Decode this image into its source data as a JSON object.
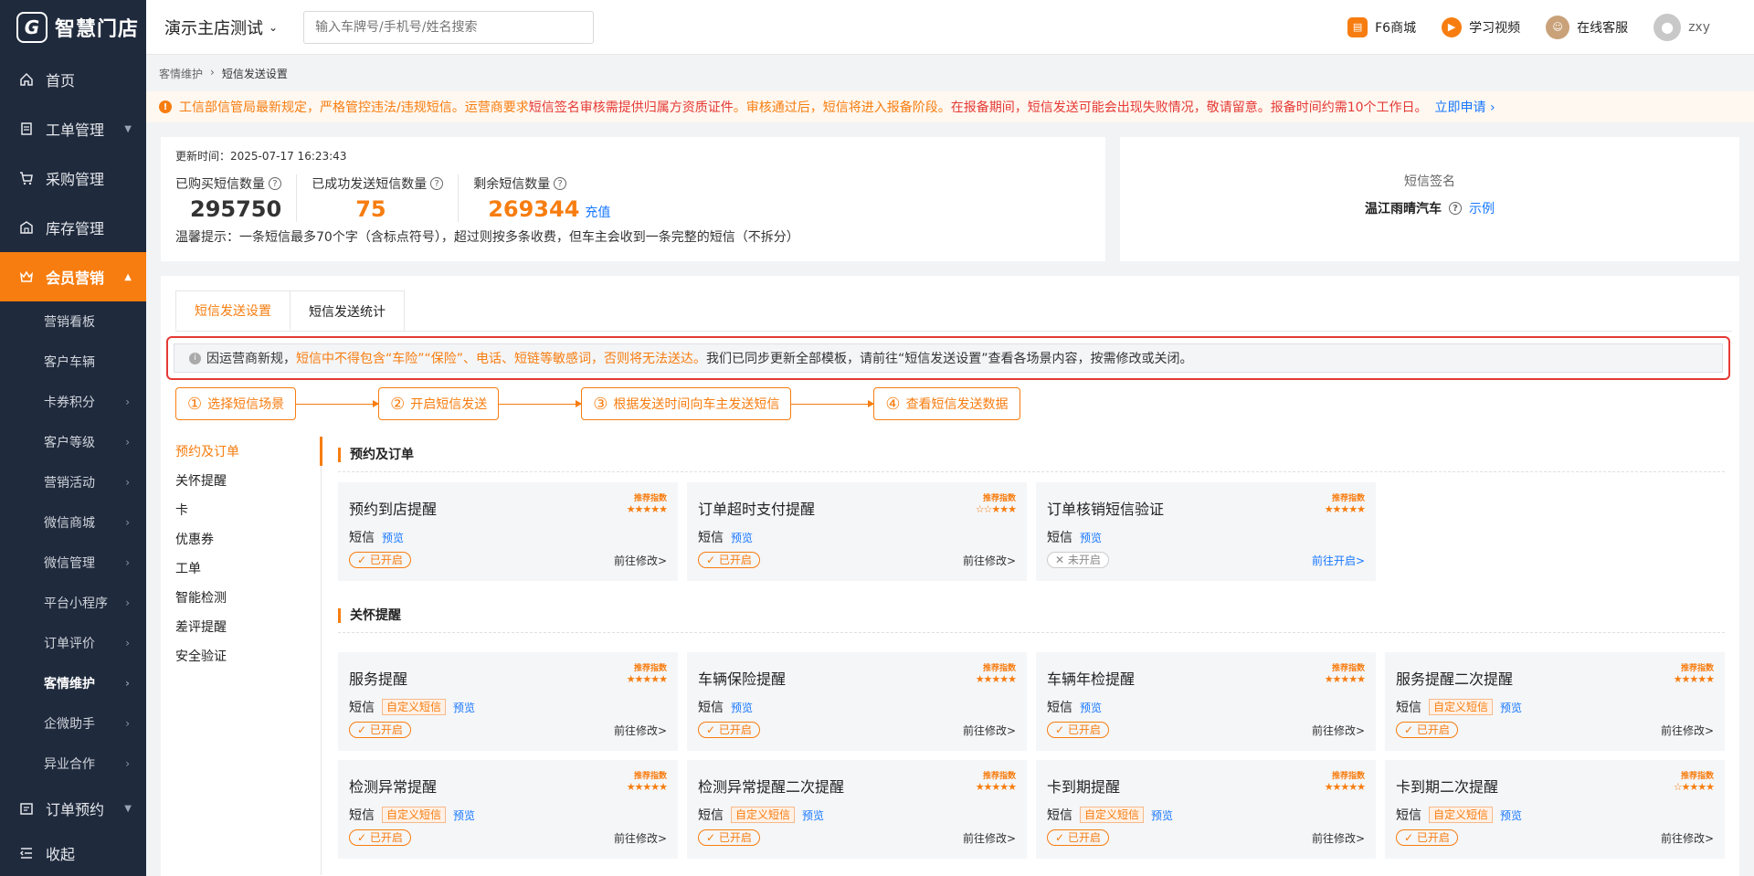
{
  "logo": {
    "mark": "G",
    "text": "智慧门店"
  },
  "nav": {
    "home": "首页",
    "work_order": "工单管理",
    "purchase": "采购管理",
    "inventory": "库存管理",
    "member": "会员营销",
    "sub": [
      "营销看板",
      "客户车辆",
      "卡券积分",
      "客户等级",
      "营销活动",
      "微信商城",
      "微信管理",
      "平台小程序",
      "订单评价",
      "客情维护",
      "企微助手",
      "异业合作"
    ],
    "order_booking": "订单预约",
    "collapse": "收起"
  },
  "topbar": {
    "store": "演示主店测试",
    "search_placeholder": "输入车牌号/手机号/姓名搜索",
    "f6": "F6商城",
    "video": "学习视频",
    "service": "在线客服",
    "user": "zxy"
  },
  "breadcrumb": {
    "parent": "客情维护",
    "current": "短信发送设置"
  },
  "notice": {
    "p1": "工信部信管局最新规定，严格管控违法/违规短信。运营商要求",
    "p2": "短信签名审核需提供归属方资质证件",
    "p3": "。审核通过后，短信将进入报备阶段。",
    "p4": "在报备期间，短信发送可能会出现失败情况，敬请留意。报备时间约需10个工作日。",
    "link": "立即申请 ›"
  },
  "stats": {
    "update_time": "更新时间：2025-07-17 16:23:43",
    "bought_label": "已购买短信数量",
    "bought_value": "295750",
    "sent_label": "已成功发送短信数量",
    "sent_value": "75",
    "remain_label": "剩余短信数量",
    "remain_value": "269344",
    "recharge": "充值",
    "tip": "温馨提示：一条短信最多70个字（含标点符号），超过则按多条收费，但车主会收到一条完整的短信（不拆分）"
  },
  "sign": {
    "title": "短信签名",
    "value": "温江雨晴汽车",
    "example": "示例"
  },
  "tabs": [
    "短信发送设置",
    "短信发送统计"
  ],
  "alert": {
    "p1": "因运营商新规，",
    "p2": "短信中不得包含“车险”“保险”、电话、短链等敏感词，否则将无法送达。",
    "p3": "我们已同步更新全部模板，请前往“短信发送设置”查看各场景内容，按需修改或关闭。"
  },
  "steps": [
    {
      "num": "①",
      "label": "选择短信场景"
    },
    {
      "num": "②",
      "label": "开启短信发送"
    },
    {
      "num": "③",
      "label": "根据发送时间向车主发送短信"
    },
    {
      "num": "④",
      "label": "查看短信发送数据"
    }
  ],
  "categories": [
    "预约及订单",
    "关怀提醒",
    "卡",
    "优惠券",
    "工单",
    "智能检测",
    "差评提醒",
    "安全验证"
  ],
  "sections": {
    "order": "预约及订单",
    "care": "关怀提醒"
  },
  "common": {
    "rec": "推荐指数",
    "sms": "短信",
    "custom": "自定义短信",
    "preview": "预览",
    "on": "✓ 已开启",
    "off": "✕ 未开启",
    "edit": "前往修改>",
    "enable": "前往开启>"
  },
  "cards_order": [
    {
      "title": "预约到店提醒",
      "stars": "★★★★★"
    },
    {
      "title": "订单超时支付提醒",
      "stars": "☆☆★★★"
    },
    {
      "title": "订单核销短信验证",
      "stars": "★★★★★"
    }
  ],
  "cards_care": [
    {
      "title": "服务提醒",
      "stars": "★★★★★"
    },
    {
      "title": "车辆保险提醒",
      "stars": "★★★★★"
    },
    {
      "title": "车辆年检提醒",
      "stars": "★★★★★"
    },
    {
      "title": "服务提醒二次提醒",
      "stars": "★★★★★"
    },
    {
      "title": "检测异常提醒",
      "stars": "★★★★★"
    },
    {
      "title": "检测异常提醒二次提醒",
      "stars": "★★★★★"
    },
    {
      "title": "卡到期提醒",
      "stars": "★★★★★"
    },
    {
      "title": "卡到期二次提醒",
      "stars": "☆★★★★"
    }
  ]
}
